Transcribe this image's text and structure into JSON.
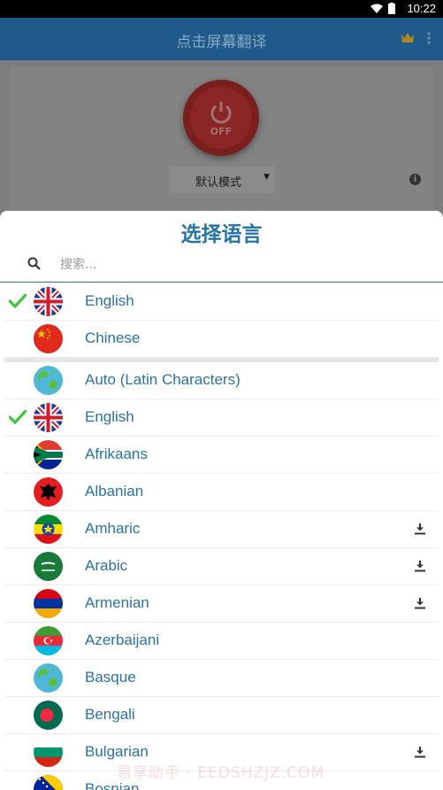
{
  "status_bar": {
    "time": "10:22"
  },
  "app_bar": {
    "title": "点击屏幕翻译"
  },
  "main": {
    "power_label": "OFF",
    "mode_label": "默认模式",
    "info_glyph": "i"
  },
  "sheet": {
    "title": "选择语言",
    "search_placeholder": "搜索...",
    "recent": [
      {
        "name": "English",
        "flag": "uk",
        "checked": true
      },
      {
        "name": "Chinese",
        "flag": "cn",
        "checked": false
      }
    ],
    "languages": [
      {
        "name": "Auto (Latin Characters)",
        "flag": "globe",
        "checked": false,
        "download": false
      },
      {
        "name": "English",
        "flag": "uk",
        "checked": true,
        "download": false
      },
      {
        "name": "Afrikaans",
        "flag": "za",
        "checked": false,
        "download": false
      },
      {
        "name": "Albanian",
        "flag": "al",
        "checked": false,
        "download": false
      },
      {
        "name": "Amharic",
        "flag": "et",
        "checked": false,
        "download": true
      },
      {
        "name": "Arabic",
        "flag": "sa",
        "checked": false,
        "download": true
      },
      {
        "name": "Armenian",
        "flag": "am",
        "checked": false,
        "download": true
      },
      {
        "name": "Azerbaijani",
        "flag": "az",
        "checked": false,
        "download": false
      },
      {
        "name": "Basque",
        "flag": "globe",
        "checked": false,
        "download": false
      },
      {
        "name": "Bengali",
        "flag": "bd",
        "checked": false,
        "download": false
      },
      {
        "name": "Bulgarian",
        "flag": "bg",
        "checked": false,
        "download": true
      },
      {
        "name": "Bosnian",
        "flag": "ba",
        "checked": false,
        "download": false
      }
    ]
  },
  "watermark": "易享助手 · EEDSHZJZ.COM",
  "colors": {
    "accent": "#2475a6",
    "app_bar": "#1f5a8a",
    "check": "#3cc43c"
  }
}
